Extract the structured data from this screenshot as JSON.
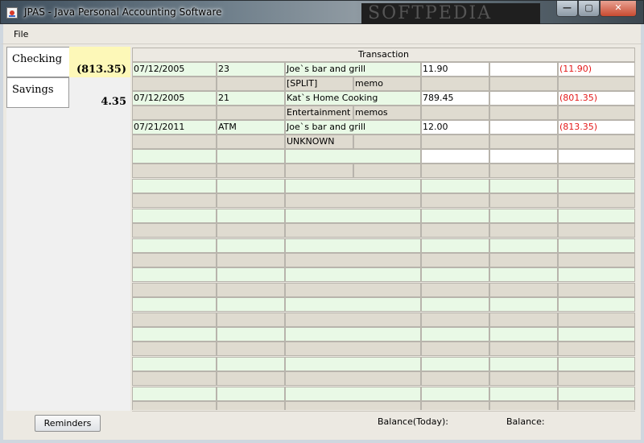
{
  "window": {
    "title": "JPAS - Java Personal Accounting Software",
    "watermark": "SOFTPEDIA"
  },
  "window_controls": {
    "minimize": "—",
    "maximize": "▢",
    "close": "✕"
  },
  "menu": {
    "items": [
      "File"
    ]
  },
  "accounts": [
    {
      "name": "Checking",
      "balance": "(813.35)",
      "selected": true
    },
    {
      "name": "Savings",
      "balance": "4.35",
      "selected": false
    }
  ],
  "register": {
    "header": "Transaction",
    "transactions": [
      {
        "date": "07/12/2005",
        "num": "23",
        "payee": "Joe`s bar and grill",
        "amount": "11.90",
        "deposit": "",
        "balance": "(11.90)",
        "category": "[SPLIT]",
        "memo": "memo"
      },
      {
        "date": "07/12/2005",
        "num": "21",
        "payee": "Kat`s Home Cooking",
        "amount": "789.45",
        "deposit": "",
        "balance": "(801.35)",
        "category": "Entertainment",
        "memo": "memos"
      },
      {
        "date": "07/21/2011",
        "num": "ATM",
        "payee": "Joe`s bar and grill",
        "amount": "12.00",
        "deposit": "",
        "balance": "(813.35)",
        "category": "UNKNOWN",
        "memo": ""
      }
    ],
    "empty_rows": 16
  },
  "buttons": {
    "reminders": "Reminders"
  },
  "status": {
    "balance_today_label": "Balance(Today):",
    "balance_label": "Balance:"
  },
  "colors": {
    "negative": "#e41a1a",
    "row_green": "#e9f9e6",
    "row_tan": "#dfdbd0",
    "selected_balance": "#fdf8b8"
  }
}
